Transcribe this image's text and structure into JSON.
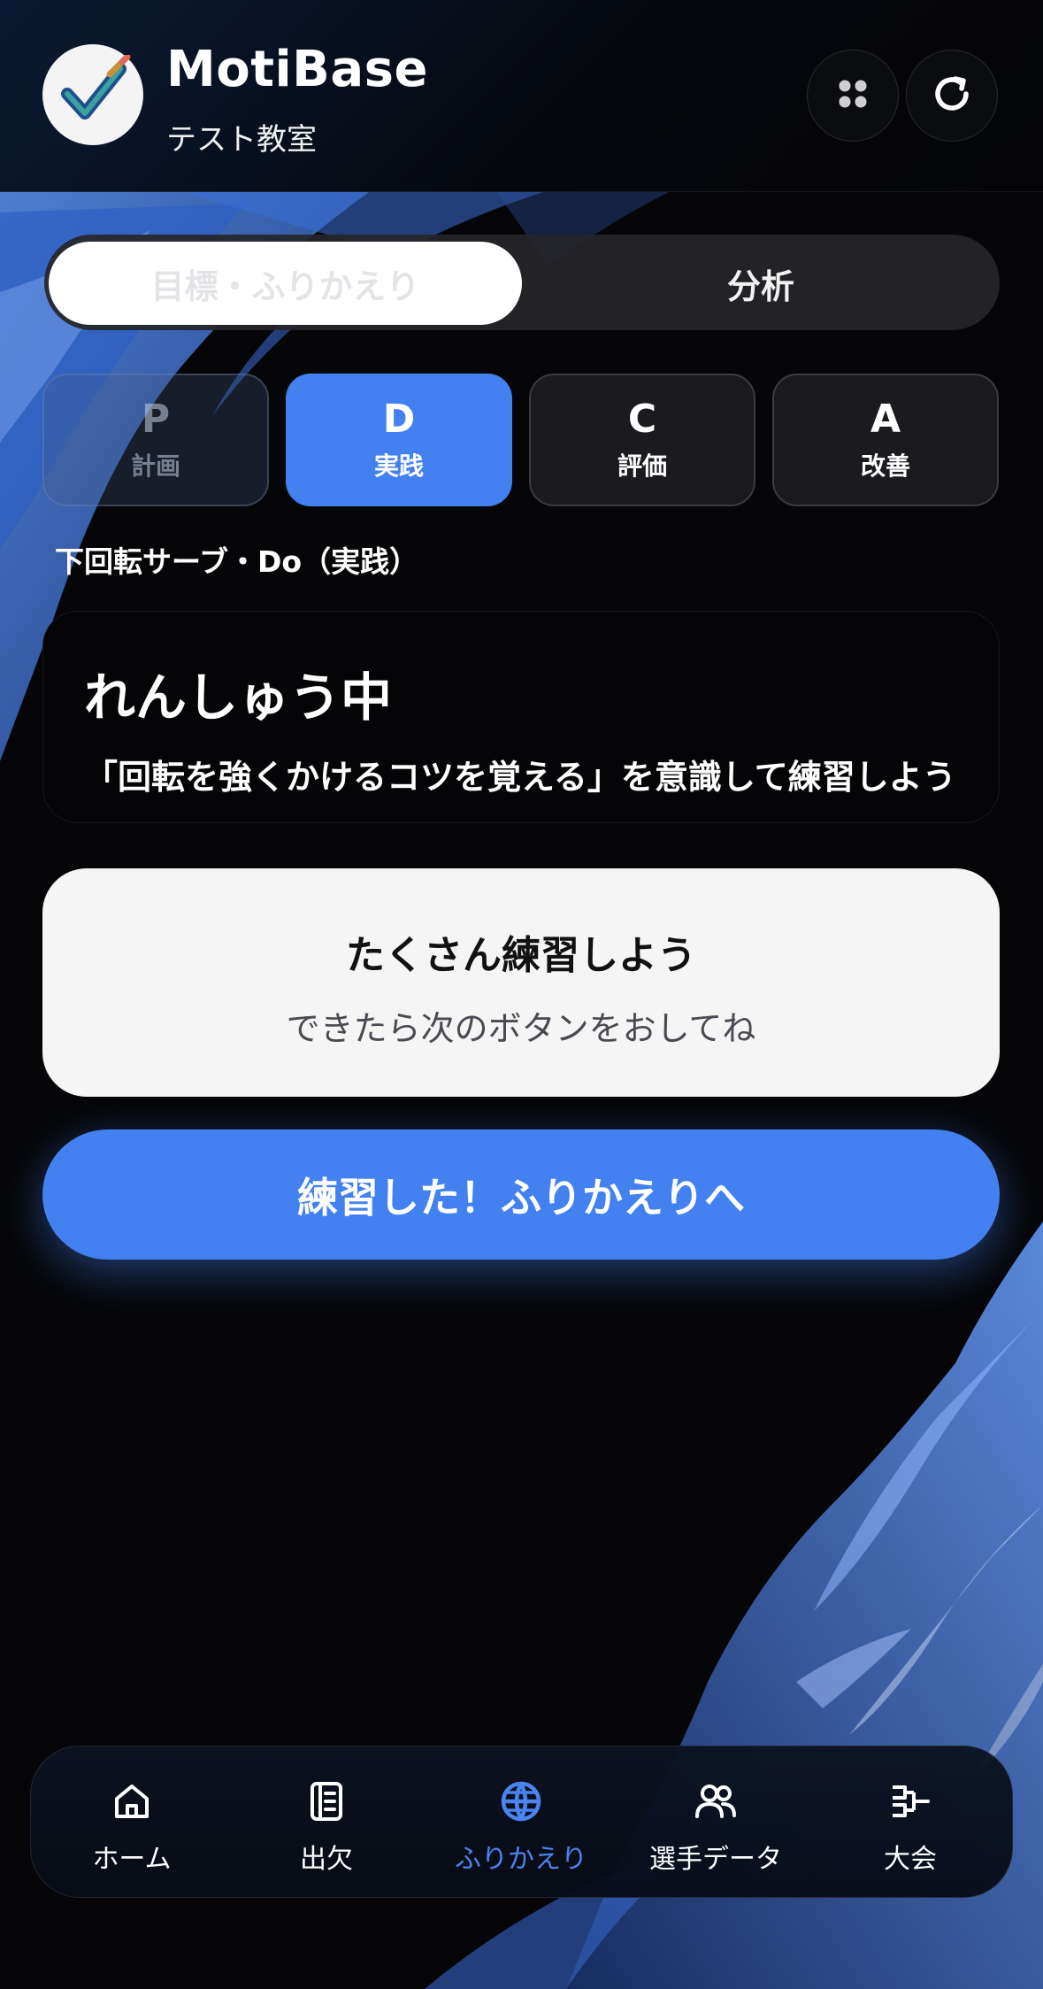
{
  "header": {
    "app_name": "MotiBase",
    "class_name": "テスト教室",
    "logo_icon": "check-pencil-icon",
    "apps_icon": "apps-grid-icon",
    "refresh_icon": "refresh-icon"
  },
  "segment_tabs": [
    {
      "label": "目標・ふりかえり",
      "active": true
    },
    {
      "label": "分析",
      "active": false
    }
  ],
  "pdca": [
    {
      "letter": "P",
      "label": "計画",
      "state": "done"
    },
    {
      "letter": "D",
      "label": "実践",
      "state": "active"
    },
    {
      "letter": "C",
      "label": "評価",
      "state": "inactive"
    },
    {
      "letter": "A",
      "label": "改善",
      "state": "inactive"
    }
  ],
  "section_label": "下回転サーブ・Do（実践）",
  "status_card": {
    "title": "れんしゅう中",
    "message": "「回転を強くかけるコツを覚える」を意識して練習しよう"
  },
  "info_card": {
    "title": "たくさん練習しよう",
    "subtitle": "できたら次のボタンをおしてね"
  },
  "action_button": {
    "label": "練習した！ふりかえりへ"
  },
  "bottom_nav": [
    {
      "label": "ホーム",
      "icon": "home-icon",
      "active": false
    },
    {
      "label": "出欠",
      "icon": "attendance-icon",
      "active": false
    },
    {
      "label": "ふりかえり",
      "icon": "reflection-globe-icon",
      "active": true
    },
    {
      "label": "選手データ",
      "icon": "players-icon",
      "active": false
    },
    {
      "label": "大会",
      "icon": "tournament-bracket-icon",
      "active": false
    }
  ],
  "colors": {
    "accent": "#4380f0",
    "background": "#060608",
    "card_light": "#f5f5f5"
  }
}
